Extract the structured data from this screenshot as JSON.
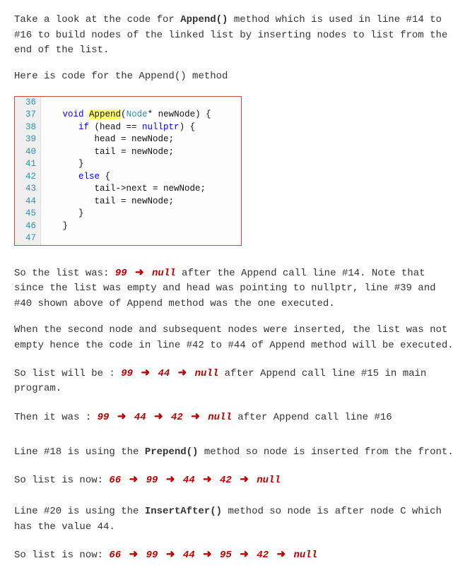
{
  "intro1_a": "Take a look at the code for ",
  "intro1_b": "Append()",
  "intro1_c": " method which is used in line #14 to #16 to build nodes of the linked list by inserting nodes to list from the end of the list.",
  "intro2": "Here is code for the Append() method",
  "code": {
    "lines": [
      {
        "n": "36",
        "indent": "",
        "tok": []
      },
      {
        "n": "37",
        "indent": "   ",
        "tok": [
          {
            "t": "void ",
            "c": "kw"
          },
          {
            "t": "Append",
            "c": "hl"
          },
          {
            "t": "(",
            "c": "op"
          },
          {
            "t": "Node",
            "c": "type"
          },
          {
            "t": "* newNode) {",
            "c": "op"
          }
        ]
      },
      {
        "n": "38",
        "indent": "      ",
        "tok": [
          {
            "t": "if",
            "c": "kw"
          },
          {
            "t": " (head == ",
            "c": "op"
          },
          {
            "t": "nullptr",
            "c": "kw"
          },
          {
            "t": ") {",
            "c": "op"
          }
        ]
      },
      {
        "n": "39",
        "indent": "         ",
        "tok": [
          {
            "t": "head = newNode;",
            "c": "op"
          }
        ]
      },
      {
        "n": "40",
        "indent": "         ",
        "tok": [
          {
            "t": "tail = newNode;",
            "c": "op"
          }
        ]
      },
      {
        "n": "41",
        "indent": "      ",
        "tok": [
          {
            "t": "}",
            "c": "op"
          }
        ]
      },
      {
        "n": "42",
        "indent": "      ",
        "tok": [
          {
            "t": "else",
            "c": "kw"
          },
          {
            "t": " {",
            "c": "op"
          }
        ]
      },
      {
        "n": "43",
        "indent": "         ",
        "tok": [
          {
            "t": "tail->next = newNode;",
            "c": "op"
          }
        ]
      },
      {
        "n": "44",
        "indent": "         ",
        "tok": [
          {
            "t": "tail = newNode;",
            "c": "op"
          }
        ]
      },
      {
        "n": "45",
        "indent": "      ",
        "tok": [
          {
            "t": "}",
            "c": "op"
          }
        ]
      },
      {
        "n": "46",
        "indent": "   ",
        "tok": [
          {
            "t": "}",
            "c": "op"
          }
        ]
      },
      {
        "n": "47",
        "indent": "",
        "tok": []
      }
    ]
  },
  "p3_a": "So the list was: ",
  "seq1": [
    "99",
    "null"
  ],
  "p3_b": " after the Append call line #14. Note that since the list was empty and head was pointing to nullptr, line #39 and #40 shown above of Append method was the one executed.",
  "p4": "When the second node and subsequent nodes were inserted, the list was not empty hence the code in line #42 to #44 of Append method will be executed.",
  "p5_a": "So list will be : ",
  "seq2": [
    "99",
    "44",
    "null"
  ],
  "p5_b": " after Append call line #15 in main program.",
  "p6_a": "Then it was : ",
  "seq3": [
    "99",
    "44",
    "42",
    "null"
  ],
  "p6_b": " after Append call line #16",
  "p7_a": "Line #18 is using the ",
  "p7_b": "Prepend()",
  "p7_c": " method so node is inserted from the front.",
  "p8_a": "So list is now: ",
  "seq4": [
    "66",
    "99",
    "44",
    "42",
    "null"
  ],
  "p9_a": "Line #20 is using the ",
  "p9_b": "InsertAfter()",
  "p9_c": " method so node is after node C which has the value 44.",
  "p10_a": "So list is now: ",
  "seq5": [
    "66",
    "99",
    "44",
    "95",
    "42",
    "null"
  ]
}
